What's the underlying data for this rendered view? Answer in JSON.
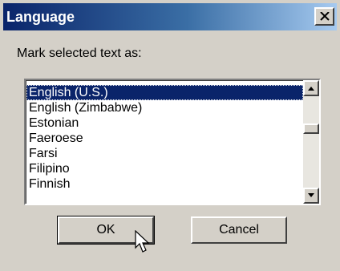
{
  "dialog": {
    "title": "Language",
    "prompt": "Mark selected text as:",
    "languages": [
      "English (U.S.)",
      "English (Zimbabwe)",
      "Estonian",
      "Faeroese",
      "Farsi",
      "Filipino",
      "Finnish"
    ],
    "selected_index": 0,
    "ok_label": "OK",
    "cancel_label": "Cancel"
  },
  "icons": {
    "close": "close-icon",
    "scroll_up": "scroll-up-arrow-icon",
    "scroll_down": "scroll-down-arrow-icon",
    "cursor": "mouse-pointer-icon"
  },
  "colors": {
    "selection": "#0a246a",
    "title_start": "#0a246a",
    "title_end": "#a6caf0",
    "face": "#d4d0c8"
  }
}
